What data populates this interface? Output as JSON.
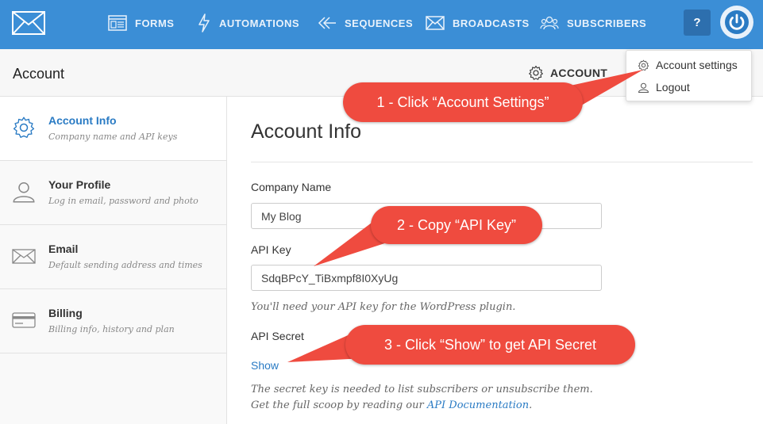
{
  "nav": {
    "items": [
      {
        "label": "FORMS",
        "icon": "forms-icon"
      },
      {
        "label": "AUTOMATIONS",
        "icon": "lightning-icon"
      },
      {
        "label": "SEQUENCES",
        "icon": "sequences-icon"
      },
      {
        "label": "BROADCASTS",
        "icon": "envelope-icon"
      },
      {
        "label": "SUBSCRIBERS",
        "icon": "people-icon"
      }
    ],
    "help_label": "?"
  },
  "subheader": {
    "title": "Account",
    "account_label": "ACCOUNT"
  },
  "dropdown": {
    "items": [
      {
        "label": "Account settings",
        "icon": "gear-icon"
      },
      {
        "label": "Logout",
        "icon": "user-icon"
      }
    ]
  },
  "sidebar": {
    "items": [
      {
        "label": "Account Info",
        "desc": "Company name and API keys",
        "icon": "gear-icon"
      },
      {
        "label": "Your Profile",
        "desc": "Log in email, password and photo",
        "icon": "user-icon"
      },
      {
        "label": "Email",
        "desc": "Default sending address and times",
        "icon": "envelope-icon"
      },
      {
        "label": "Billing",
        "desc": "Billing info, history and plan",
        "icon": "credit-card-icon"
      }
    ]
  },
  "main": {
    "title": "Account Info",
    "company_label": "Company Name",
    "company_value": "My Blog",
    "api_key_label": "API Key",
    "api_key_value": "SdqBPcY_TiBxmpf8I0XyUg",
    "api_key_hint": "You'll need your API key for the WordPress plugin.",
    "api_secret_label": "API Secret",
    "show_label": "Show",
    "secret_hint_line1": "The secret key is needed to list subscribers or unsubscribe them.",
    "secret_hint_line2_prefix": "Get the full scoop by reading our",
    "secret_hint_link": "API Documentation",
    "secret_hint_suffix": "."
  },
  "callouts": {
    "one": "1 - Click “Account Settings”",
    "two": "2 - Copy “API Key”",
    "three": "3 - Click “Show” to get API Secret"
  },
  "colors": {
    "nav_bg": "#3b8ed6",
    "accent": "#2a7bc4",
    "callout": "#ef4b3f"
  }
}
